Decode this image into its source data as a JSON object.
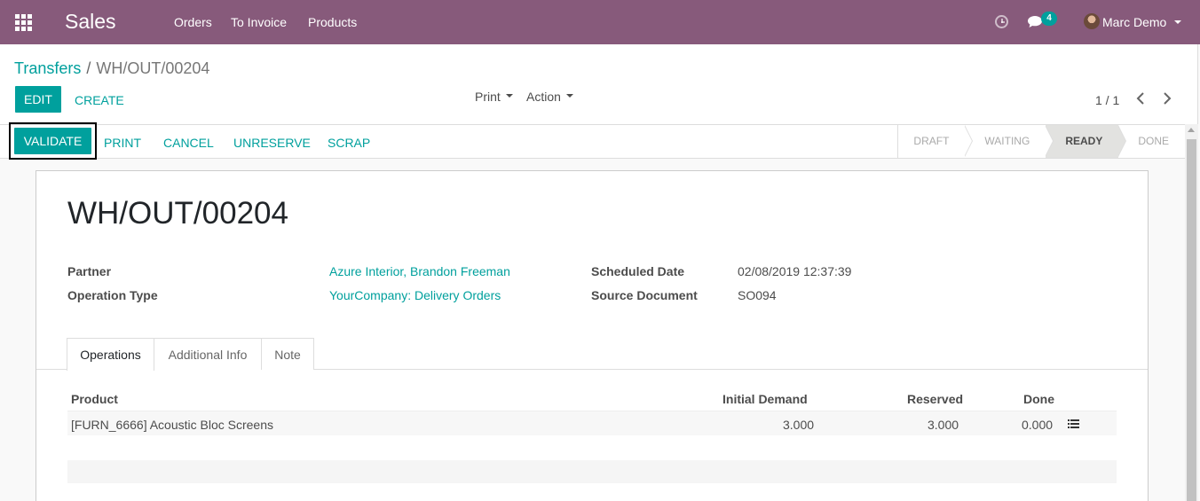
{
  "navbar": {
    "app_name": "Sales",
    "menu": [
      "Orders",
      "To Invoice",
      "Products"
    ],
    "chat_count": "4",
    "user_name": "Marc Demo",
    "color": "#875a7b"
  },
  "breadcrumb": {
    "parent": "Transfers",
    "separator": "/",
    "current": "WH/OUT/00204"
  },
  "control": {
    "edit_label": "EDIT",
    "create_label": "CREATE",
    "print_label": "Print",
    "action_label": "Action",
    "pager": "1 / 1"
  },
  "statusbar": {
    "buttons": [
      "VALIDATE",
      "PRINT",
      "CANCEL",
      "UNRESERVE",
      "SCRAP"
    ],
    "stages": [
      "DRAFT",
      "WAITING",
      "READY",
      "DONE"
    ],
    "active_stage": "READY"
  },
  "record": {
    "title": "WH/OUT/00204",
    "partner_label": "Partner",
    "partner_value": "Azure Interior, Brandon Freeman",
    "operation_type_label": "Operation Type",
    "operation_type_value": "YourCompany: Delivery Orders",
    "scheduled_date_label": "Scheduled Date",
    "scheduled_date_value": "02/08/2019 12:37:39",
    "source_document_label": "Source Document",
    "source_document_value": "SO094"
  },
  "tabs": [
    "Operations",
    "Additional Info",
    "Note"
  ],
  "table": {
    "headers": [
      "Product",
      "Initial Demand",
      "Reserved",
      "Done"
    ],
    "rows": [
      {
        "product": "[FURN_6666] Acoustic Bloc Screens",
        "initial_demand": "3.000",
        "reserved": "3.000",
        "done": "0.000"
      }
    ]
  },
  "colors": {
    "accent": "#00a09d",
    "brand": "#875a7b"
  },
  "icons": [
    "apps-icon",
    "clock-icon",
    "chat-icon",
    "caret-down-icon",
    "chevron-left-icon",
    "chevron-right-icon",
    "list-icon"
  ]
}
